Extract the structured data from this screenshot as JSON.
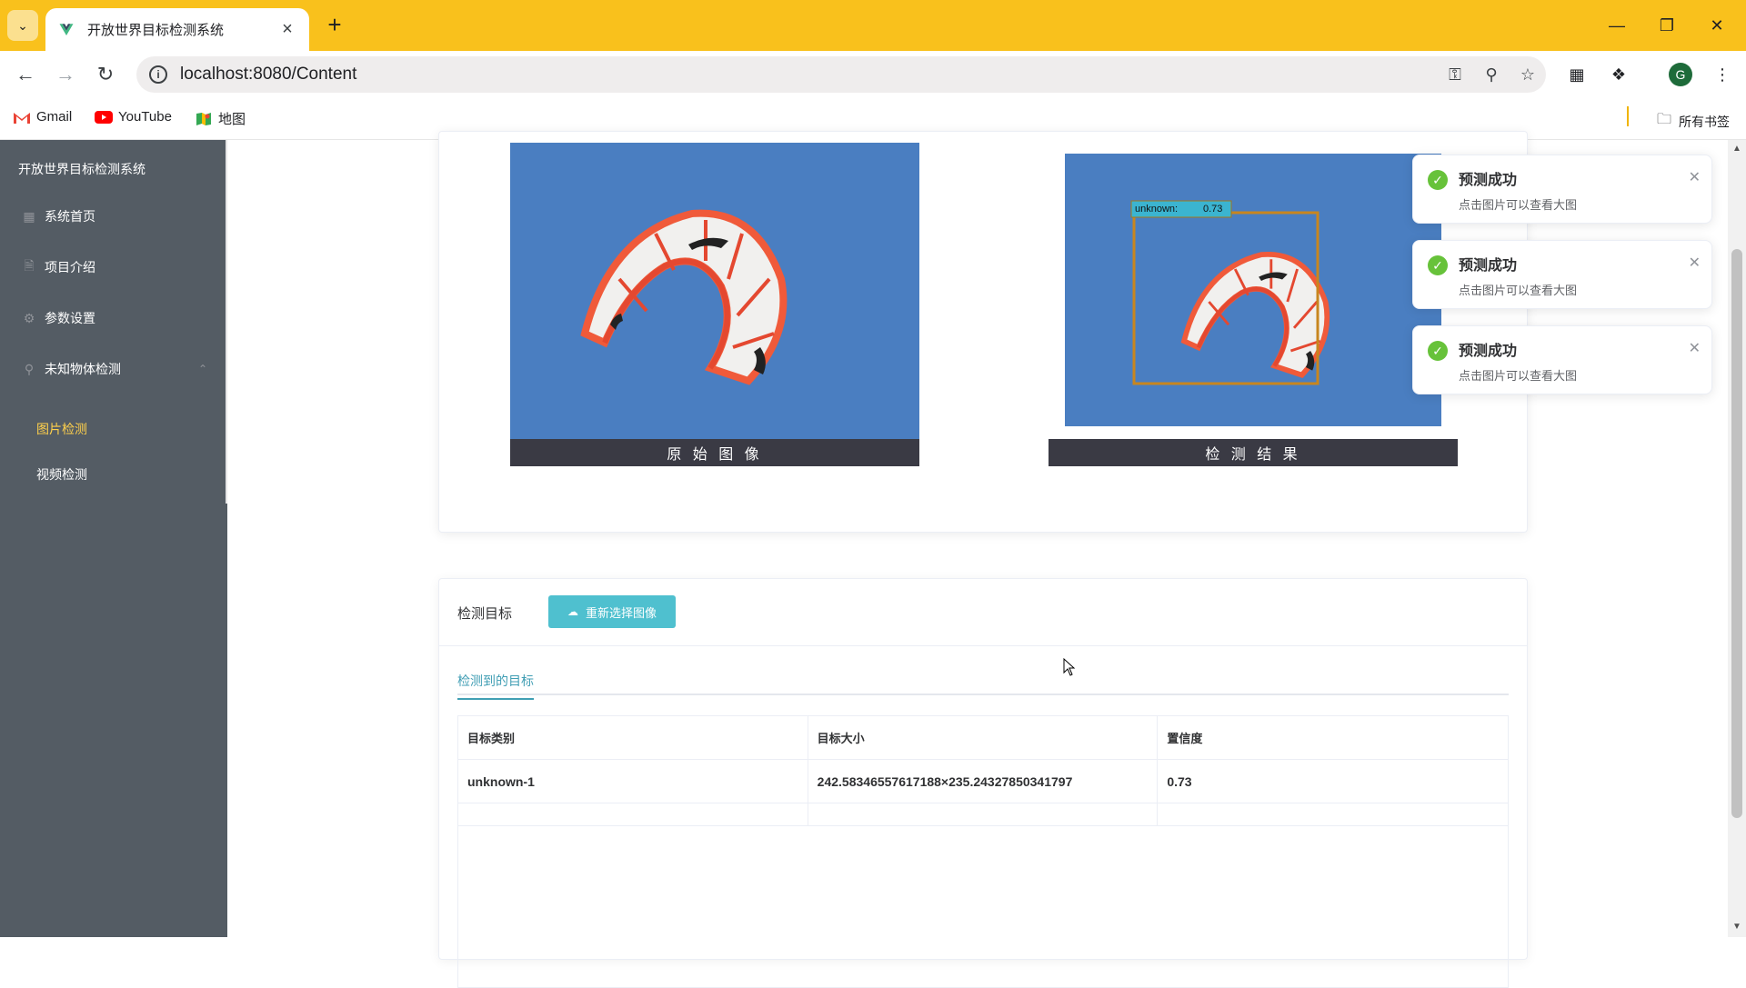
{
  "browser": {
    "tab_title": "开放世界目标检测系统",
    "url": "localhost:8080/Content",
    "bookmarks": [
      "Gmail",
      "YouTube",
      "地图"
    ],
    "bookmarks_folder": "所有书签",
    "avatar_letter": "G"
  },
  "sidebar": {
    "title": "开放世界目标检测系统",
    "items": [
      {
        "label": "系统首页",
        "icon": "grid-icon"
      },
      {
        "label": "项目介绍",
        "icon": "document-icon"
      },
      {
        "label": "参数设置",
        "icon": "gear-icon"
      },
      {
        "label": "未知物体检测",
        "icon": "location-icon"
      }
    ],
    "sub_items": [
      "图片检测",
      "视频检测"
    ],
    "active_sub": "图片检测"
  },
  "images": {
    "original_caption": "原 始 图 像",
    "result_caption": "检 测 结 果",
    "detection_label": "unknown:",
    "detection_score": "0.73"
  },
  "targets": {
    "header_label": "检测目标",
    "reselect_button": "重新选择图像",
    "tab_label": "检测到的目标",
    "columns": [
      "目标类别",
      "目标大小",
      "置信度"
    ],
    "rows": [
      {
        "category": "unknown-1",
        "size": "242.58346557617188×235.24327850341797",
        "confidence": "0.73"
      }
    ]
  },
  "notifications": [
    {
      "title": "预测成功",
      "message": "点击图片可以查看大图"
    },
    {
      "title": "预测成功",
      "message": "点击图片可以查看大图"
    },
    {
      "title": "预测成功",
      "message": "点击图片可以查看大图"
    }
  ],
  "colors": {
    "sidebar_bg": "#545c64",
    "active_menu": "#ffd04b",
    "accent": "#4fc0cf",
    "success": "#67c23a",
    "browser_frame": "#f9c11c"
  }
}
